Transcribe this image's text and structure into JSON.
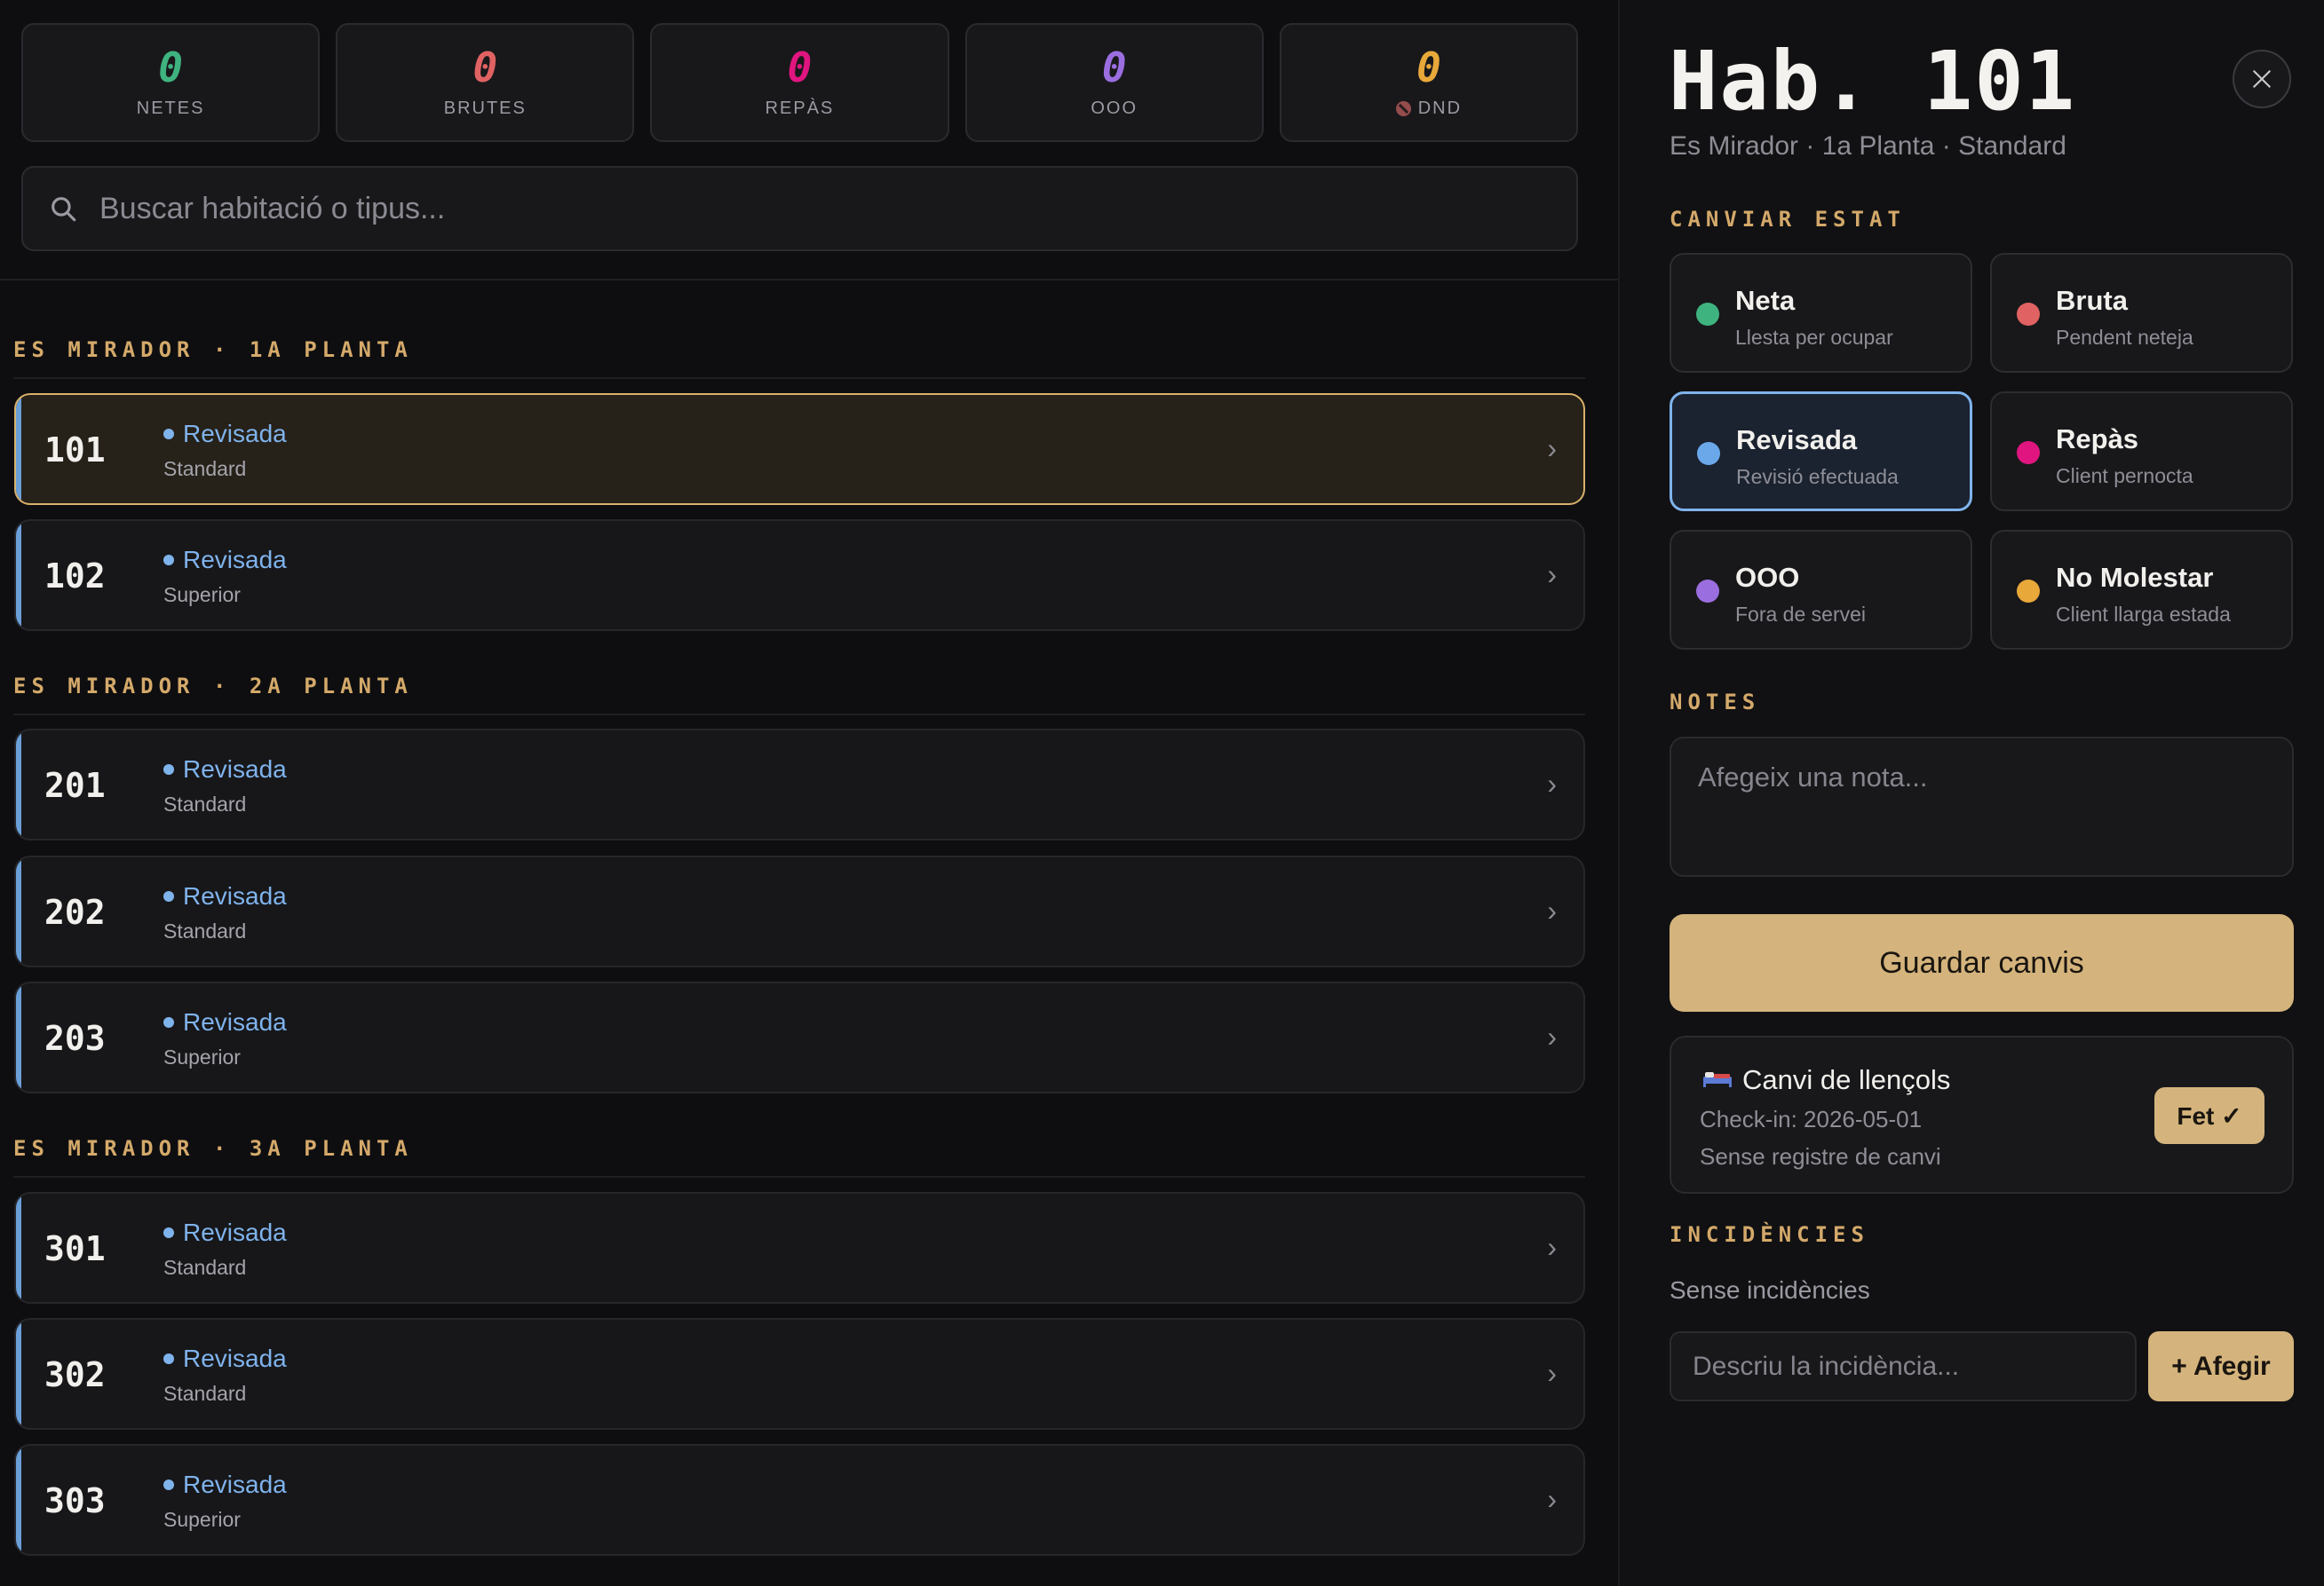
{
  "stats": [
    {
      "value": "0",
      "label": "NETES",
      "color": "#3fb37f"
    },
    {
      "value": "0",
      "label": "BRUTES",
      "color": "#e06262"
    },
    {
      "value": "0",
      "label": "REPÀS",
      "color": "#e0157f"
    },
    {
      "value": "0",
      "label": "OOO",
      "color": "#9b6ee0"
    },
    {
      "value": "0",
      "label": "DND",
      "color": "#e8a83a"
    }
  ],
  "search": {
    "placeholder": "Buscar habitació o tipus..."
  },
  "floors": [
    {
      "heading": "ES MIRADOR · 1A PLANTA",
      "rooms": [
        {
          "number": "101",
          "status": "Revisada",
          "type": "Standard"
        },
        {
          "number": "102",
          "status": "Revisada",
          "type": "Superior"
        }
      ]
    },
    {
      "heading": "ES MIRADOR · 2A PLANTA",
      "rooms": [
        {
          "number": "201",
          "status": "Revisada",
          "type": "Standard"
        },
        {
          "number": "202",
          "status": "Revisada",
          "type": "Standard"
        },
        {
          "number": "203",
          "status": "Revisada",
          "type": "Superior"
        }
      ]
    },
    {
      "heading": "ES MIRADOR · 3A PLANTA",
      "rooms": [
        {
          "number": "301",
          "status": "Revisada",
          "type": "Standard"
        },
        {
          "number": "302",
          "status": "Revisada",
          "type": "Standard"
        },
        {
          "number": "303",
          "status": "Revisada",
          "type": "Superior"
        }
      ]
    }
  ],
  "detail": {
    "title": "Hab. 101",
    "subtitle": "Es Mirador · 1a Planta · Standard",
    "change_state_label": "CANVIAR ESTAT",
    "states": [
      {
        "name": "Neta",
        "desc": "Llesta per ocupar",
        "color": "#3fb37f"
      },
      {
        "name": "Bruta",
        "desc": "Pendent neteja",
        "color": "#e06262"
      },
      {
        "name": "Revisada",
        "desc": "Revisió efectuada",
        "color": "#6aa8ea"
      },
      {
        "name": "Repàs",
        "desc": "Client pernocta",
        "color": "#e0157f"
      },
      {
        "name": "OOO",
        "desc": "Fora de servei",
        "color": "#9b6ee0"
      },
      {
        "name": "No Molestar",
        "desc": "Client llarga estada",
        "color": "#e8a83a"
      }
    ],
    "notes_label": "NOTES",
    "notes_placeholder": "Afegeix una nota...",
    "save_label": "Guardar canvis",
    "linen": {
      "title": "Canvi de llençols",
      "checkin": "Check-in: 2026-05-01",
      "note": "Sense registre de canvi",
      "done_label": "Fet ✓"
    },
    "incidents_label": "INCIDÈNCIES",
    "no_incidents": "Sense incidències",
    "incident_placeholder": "Descriu la incidència...",
    "add_label": "+ Afegir"
  }
}
